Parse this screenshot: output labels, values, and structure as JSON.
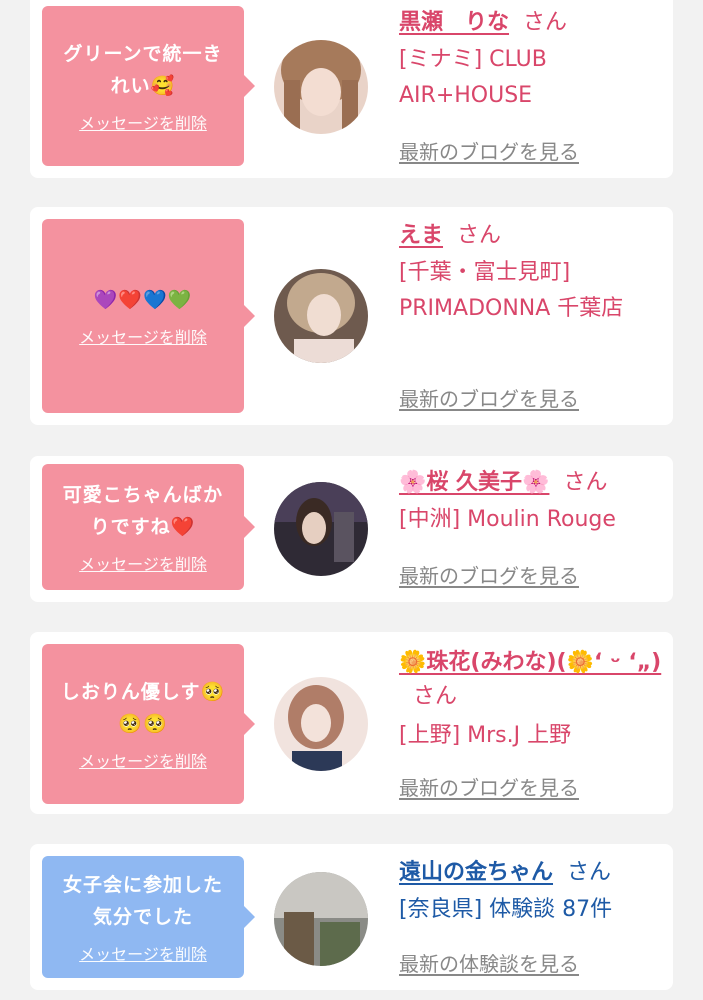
{
  "colors": {
    "pink_bubble": "#f4929f",
    "blue_bubble": "#8fb8f2",
    "pink_text": "#d9466a",
    "blue_text": "#1e5aa6",
    "link_gray": "#888888"
  },
  "cards": [
    {
      "message": "グリーンで統一き\nれい🥰",
      "delete_label": "メッセージを削除",
      "name": "黒瀬　りな",
      "honorific": "さん",
      "shop": "[ミナミ] CLUB AIR+HOUSE",
      "link": "最新のブログを見る"
    },
    {
      "message": "💜❤️💙💚",
      "delete_label": "メッセージを削除",
      "name": "えま",
      "honorific": "さん",
      "shop": "[千葉・富士見町] PRIMADONNA 千葉店",
      "link": "最新のブログを見る"
    },
    {
      "message": "可愛こちゃんばか\nりですね❤️",
      "delete_label": "メッセージを削除",
      "name": "🌸桜 久美子🌸",
      "honorific": "さん",
      "shop": "[中洲] Moulin Rouge",
      "link": "最新のブログを見る"
    },
    {
      "message": "しおりん優しす🥺\n🥺🥺",
      "delete_label": "メッセージを削除",
      "name": "🌼珠花(みわな)(🌼‘ ᵕ ‘„)",
      "honorific": "さん",
      "shop": "[上野] Mrs.J 上野",
      "link": "最新のブログを見る"
    },
    {
      "message": "女子会に参加した\n気分でした",
      "delete_label": "メッセージを削除",
      "name": "遠山の金ちゃん",
      "honorific": "さん",
      "shop": "[奈良県] 体験談 87件",
      "link": "最新の体験談を見る"
    }
  ]
}
